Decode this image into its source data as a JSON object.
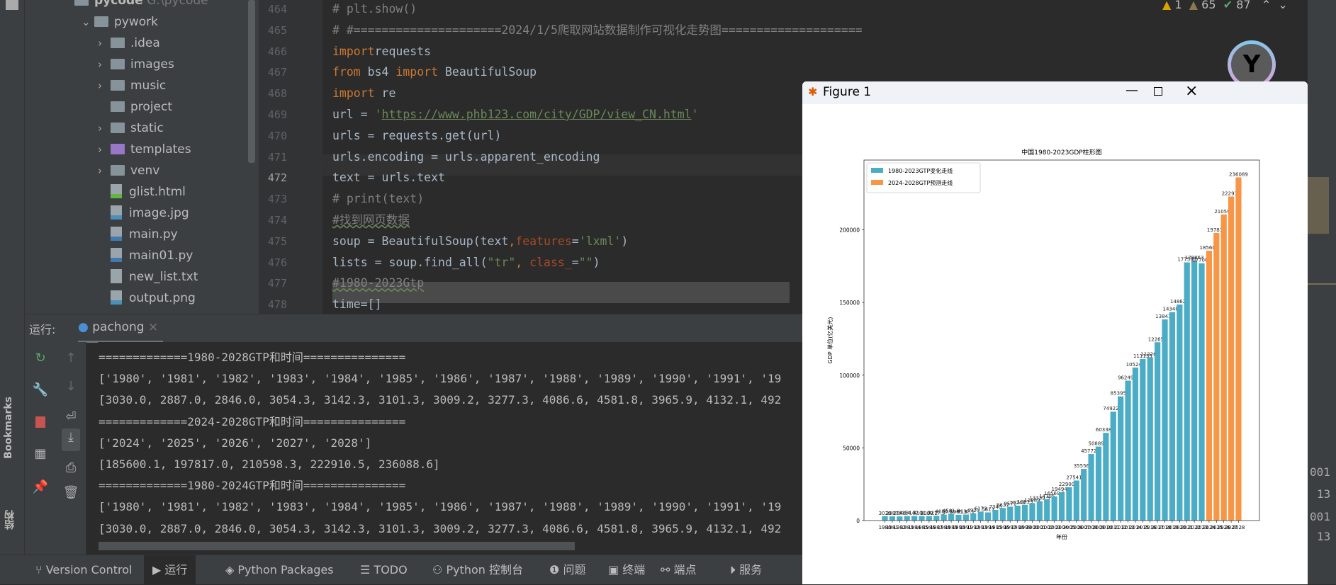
{
  "project_tree": {
    "root": {
      "name": "pycode",
      "path": "G:\\pycode"
    },
    "items": [
      {
        "label": "pywork",
        "kind": "folder",
        "expanded": true,
        "depth": 1
      },
      {
        "label": ".idea",
        "kind": "folder",
        "depth": 2,
        "chevron": true
      },
      {
        "label": "images",
        "kind": "folder",
        "depth": 2,
        "chevron": true
      },
      {
        "label": "music",
        "kind": "folder",
        "depth": 2,
        "chevron": true
      },
      {
        "label": "project",
        "kind": "folder",
        "depth": 2,
        "chevron": false
      },
      {
        "label": "static",
        "kind": "folder",
        "depth": 2,
        "chevron": true
      },
      {
        "label": "templates",
        "kind": "folder-purple",
        "depth": 2,
        "chevron": true
      },
      {
        "label": "venv",
        "kind": "folder",
        "depth": 2,
        "chevron": true
      },
      {
        "label": "glist.html",
        "kind": "html",
        "depth": 2
      },
      {
        "label": "image.jpg",
        "kind": "image",
        "depth": 2
      },
      {
        "label": "main.py",
        "kind": "python",
        "depth": 2
      },
      {
        "label": "main01.py",
        "kind": "python",
        "depth": 2
      },
      {
        "label": "new_list.txt",
        "kind": "text",
        "depth": 2
      },
      {
        "label": "output.png",
        "kind": "image",
        "depth": 2
      }
    ]
  },
  "left_strip": {
    "bookmarks": "Bookmarks",
    "structure": "结构"
  },
  "editor": {
    "current_line": "472",
    "lines": [
      {
        "n": "464",
        "tokens": [
          [
            "cm",
            "# plt.show()"
          ]
        ]
      },
      {
        "n": "465",
        "tokens": [
          [
            "cm",
            "# #=====================2024/1/5爬取网站数据制作可视化走势图===================="
          ]
        ]
      },
      {
        "n": "466",
        "tokens": [
          [
            "kw",
            "import"
          ],
          [
            "",
            "requests"
          ]
        ]
      },
      {
        "n": "467",
        "tokens": [
          [
            "kw",
            "from"
          ],
          [
            "",
            " bs4 "
          ],
          [
            "kw",
            "import"
          ],
          [
            "",
            " BeautifulSoup"
          ]
        ]
      },
      {
        "n": "468",
        "tokens": [
          [
            "kw",
            "import"
          ],
          [
            "",
            " re"
          ]
        ]
      },
      {
        "n": "469",
        "tokens": [
          [
            "",
            "url = "
          ],
          [
            "str",
            "'"
          ],
          [
            "url",
            "https://www.phb123.com/city/GDP/view_CN.html"
          ],
          [
            "str",
            "'"
          ]
        ]
      },
      {
        "n": "470",
        "tokens": [
          [
            "",
            "urls = requests.get(url)"
          ]
        ]
      },
      {
        "n": "471",
        "tokens": [
          [
            "",
            "urls.encoding = urls.apparent_encoding"
          ]
        ]
      },
      {
        "n": "472",
        "tokens": [
          [
            "",
            "text = urls.text"
          ]
        ]
      },
      {
        "n": "473",
        "tokens": [
          [
            "cm",
            "# print(text)"
          ]
        ]
      },
      {
        "n": "474",
        "tokens": [
          [
            "cmw",
            "#找到网页数据"
          ]
        ]
      },
      {
        "n": "475",
        "tokens": [
          [
            "",
            "soup = BeautifulSoup(text"
          ],
          [
            "kw",
            ","
          ],
          [
            "param",
            "features"
          ],
          [
            "",
            "="
          ],
          [
            "str",
            "'lxml'"
          ],
          [
            "",
            ")"
          ]
        ]
      },
      {
        "n": "476",
        "tokens": [
          [
            "",
            "lists = soup.find_all("
          ],
          [
            "str",
            "\"tr\""
          ],
          [
            "kw",
            ", "
          ],
          [
            "param",
            "class_"
          ],
          [
            "",
            "="
          ],
          [
            "str",
            "\"\""
          ],
          [
            "",
            ")"
          ]
        ]
      },
      {
        "n": "477",
        "tokens": [
          [
            "cmw",
            "#1980-2023Gtp"
          ]
        ]
      },
      {
        "n": "478",
        "tokens": [
          [
            "",
            "time=[]"
          ]
        ]
      }
    ]
  },
  "inspections": {
    "warnings": "1",
    "weak_warnings": "65",
    "typos": "87"
  },
  "run_panel": {
    "label": "运行:",
    "tab": "pachong",
    "console_lines": [
      "=============1980-2028GTP和时间===============",
      "['1980', '1981', '1982', '1983', '1984', '1985', '1986', '1987', '1988', '1989', '1990', '1991', '19",
      "[3030.0, 2887.0, 2846.0, 3054.3, 3142.3, 3101.3, 3009.2, 3277.3, 4086.6, 4581.8, 3965.9, 4132.1, 492",
      "=============2024-2028GTP和时间===============",
      "['2024', '2025', '2026', '2027', '2028']",
      "[185600.1, 197817.0, 210598.3, 222910.5, 236088.6]",
      "=============1980-2024GTP和时间===============",
      "['1980', '1981', '1982', '1983', '1984', '1985', '1986', '1987', '1988', '1989', '1990', '1991', '19",
      "[3030.0, 2887.0, 2846.0, 3054.3, 3142.3, 3101.3, 3009.2, 3277.3, 4086.6, 4581.8, 3965.9, 4132.1, 492"
    ],
    "right_fragments": [
      "001",
      "13",
      "001",
      "13"
    ]
  },
  "status_bar": {
    "items": [
      "Version Control",
      "运行",
      "Python Packages",
      "TODO",
      "Python 控制台",
      "问题",
      "终端",
      "端点",
      "服务"
    ]
  },
  "figure_window": {
    "title": "Figure 1"
  },
  "chart_data": {
    "type": "bar",
    "title": "中国1980-2023GDP柱形图",
    "xlabel": "年份",
    "ylabel": "GDP 单位(亿美元)",
    "ylim": [
      0,
      248000
    ],
    "yticks": [
      0,
      50000,
      100000,
      150000,
      200000
    ],
    "legend_placement": "upper-left",
    "grid": false,
    "series": [
      {
        "name": "1980-2023GTP变化走线",
        "color": "#4bacc6",
        "categories": [
          "1980",
          "1981",
          "1982",
          "1983",
          "1984",
          "1985",
          "1986",
          "1987",
          "1988",
          "1989",
          "1990",
          "1991",
          "1992",
          "1993",
          "1994",
          "1995",
          "1996",
          "1997",
          "1998",
          "1999",
          "2000",
          "2001",
          "2002",
          "2003",
          "2004",
          "2005",
          "2006",
          "2007",
          "2008",
          "2009",
          "2010",
          "2011",
          "2012",
          "2013",
          "2014",
          "2015",
          "2016",
          "2017",
          "2018",
          "2019",
          "2020",
          "2021",
          "2022",
          "2023"
        ],
        "values": [
          3030,
          2887,
          2846,
          3054.3,
          3142.3,
          3101.3,
          3009.2,
          3277.3,
          4086.6,
          4581.8,
          3965.9,
          4132.1,
          4921,
          6173,
          5613,
          7340,
          8637,
          9571,
          10240,
          10833,
          11989,
          13339.5,
          14705,
          16569.6,
          19494.5,
          22900.2,
          27541.5,
          35556.6,
          45772.8,
          50889.9,
          60338.3,
          74922.1,
          85395.8,
          96249.3,
          105242,
          111135,
          112269,
          122653,
          138418,
          143406,
          148626,
          177593,
          178863,
          177009
        ]
      },
      {
        "name": "2024-2028GTP预测走线",
        "color": "#f79646",
        "categories": [
          "2024",
          "2025",
          "2026",
          "2027",
          "2028"
        ],
        "values": [
          185600,
          197817,
          210598,
          222910,
          236089
        ]
      }
    ]
  }
}
